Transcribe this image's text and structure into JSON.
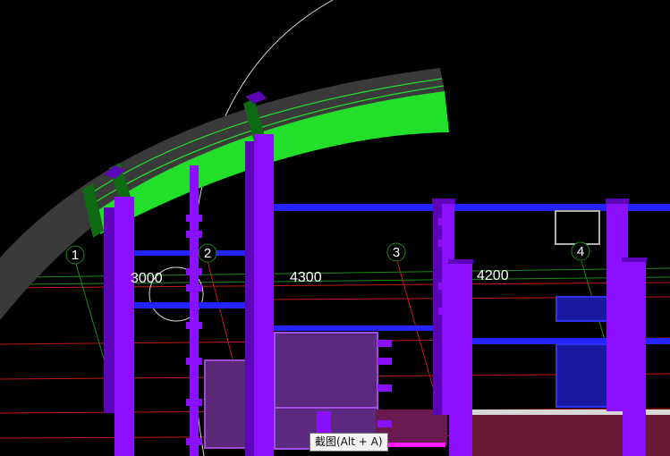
{
  "viewport": {
    "background": "#000000",
    "colors": {
      "column": "#8a10ff",
      "column_dark": "#5d05b8",
      "roof_green": "#22e02a",
      "roof_dark": "#3a3a3a",
      "beam_blue": "#2424ff",
      "axis_green": "#1a8a1a",
      "grid_red": "#c01818",
      "floor_magenta": "#ff1aff"
    }
  },
  "axes": [
    {
      "label": "1"
    },
    {
      "label": "2"
    },
    {
      "label": "3"
    },
    {
      "label": "4"
    }
  ],
  "dimensions": [
    {
      "label": "3000"
    },
    {
      "label": "4300"
    },
    {
      "label": "4200"
    }
  ],
  "tooltip": {
    "text": "截图(Alt + A)"
  }
}
